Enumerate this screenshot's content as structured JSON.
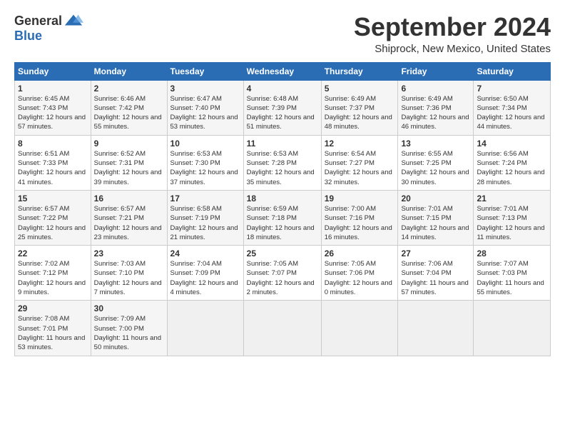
{
  "logo": {
    "general": "General",
    "blue": "Blue"
  },
  "title": "September 2024",
  "location": "Shiprock, New Mexico, United States",
  "days_of_week": [
    "Sunday",
    "Monday",
    "Tuesday",
    "Wednesday",
    "Thursday",
    "Friday",
    "Saturday"
  ],
  "weeks": [
    [
      {
        "num": "1",
        "sunrise": "6:45 AM",
        "sunset": "7:43 PM",
        "daylight": "12 hours and 57 minutes."
      },
      {
        "num": "2",
        "sunrise": "6:46 AM",
        "sunset": "7:42 PM",
        "daylight": "12 hours and 55 minutes."
      },
      {
        "num": "3",
        "sunrise": "6:47 AM",
        "sunset": "7:40 PM",
        "daylight": "12 hours and 53 minutes."
      },
      {
        "num": "4",
        "sunrise": "6:48 AM",
        "sunset": "7:39 PM",
        "daylight": "12 hours and 51 minutes."
      },
      {
        "num": "5",
        "sunrise": "6:49 AM",
        "sunset": "7:37 PM",
        "daylight": "12 hours and 48 minutes."
      },
      {
        "num": "6",
        "sunrise": "6:49 AM",
        "sunset": "7:36 PM",
        "daylight": "12 hours and 46 minutes."
      },
      {
        "num": "7",
        "sunrise": "6:50 AM",
        "sunset": "7:34 PM",
        "daylight": "12 hours and 44 minutes."
      }
    ],
    [
      {
        "num": "8",
        "sunrise": "6:51 AM",
        "sunset": "7:33 PM",
        "daylight": "12 hours and 41 minutes."
      },
      {
        "num": "9",
        "sunrise": "6:52 AM",
        "sunset": "7:31 PM",
        "daylight": "12 hours and 39 minutes."
      },
      {
        "num": "10",
        "sunrise": "6:53 AM",
        "sunset": "7:30 PM",
        "daylight": "12 hours and 37 minutes."
      },
      {
        "num": "11",
        "sunrise": "6:53 AM",
        "sunset": "7:28 PM",
        "daylight": "12 hours and 35 minutes."
      },
      {
        "num": "12",
        "sunrise": "6:54 AM",
        "sunset": "7:27 PM",
        "daylight": "12 hours and 32 minutes."
      },
      {
        "num": "13",
        "sunrise": "6:55 AM",
        "sunset": "7:25 PM",
        "daylight": "12 hours and 30 minutes."
      },
      {
        "num": "14",
        "sunrise": "6:56 AM",
        "sunset": "7:24 PM",
        "daylight": "12 hours and 28 minutes."
      }
    ],
    [
      {
        "num": "15",
        "sunrise": "6:57 AM",
        "sunset": "7:22 PM",
        "daylight": "12 hours and 25 minutes."
      },
      {
        "num": "16",
        "sunrise": "6:57 AM",
        "sunset": "7:21 PM",
        "daylight": "12 hours and 23 minutes."
      },
      {
        "num": "17",
        "sunrise": "6:58 AM",
        "sunset": "7:19 PM",
        "daylight": "12 hours and 21 minutes."
      },
      {
        "num": "18",
        "sunrise": "6:59 AM",
        "sunset": "7:18 PM",
        "daylight": "12 hours and 18 minutes."
      },
      {
        "num": "19",
        "sunrise": "7:00 AM",
        "sunset": "7:16 PM",
        "daylight": "12 hours and 16 minutes."
      },
      {
        "num": "20",
        "sunrise": "7:01 AM",
        "sunset": "7:15 PM",
        "daylight": "12 hours and 14 minutes."
      },
      {
        "num": "21",
        "sunrise": "7:01 AM",
        "sunset": "7:13 PM",
        "daylight": "12 hours and 11 minutes."
      }
    ],
    [
      {
        "num": "22",
        "sunrise": "7:02 AM",
        "sunset": "7:12 PM",
        "daylight": "12 hours and 9 minutes."
      },
      {
        "num": "23",
        "sunrise": "7:03 AM",
        "sunset": "7:10 PM",
        "daylight": "12 hours and 7 minutes."
      },
      {
        "num": "24",
        "sunrise": "7:04 AM",
        "sunset": "7:09 PM",
        "daylight": "12 hours and 4 minutes."
      },
      {
        "num": "25",
        "sunrise": "7:05 AM",
        "sunset": "7:07 PM",
        "daylight": "12 hours and 2 minutes."
      },
      {
        "num": "26",
        "sunrise": "7:05 AM",
        "sunset": "7:06 PM",
        "daylight": "12 hours and 0 minutes."
      },
      {
        "num": "27",
        "sunrise": "7:06 AM",
        "sunset": "7:04 PM",
        "daylight": "11 hours and 57 minutes."
      },
      {
        "num": "28",
        "sunrise": "7:07 AM",
        "sunset": "7:03 PM",
        "daylight": "11 hours and 55 minutes."
      }
    ],
    [
      {
        "num": "29",
        "sunrise": "7:08 AM",
        "sunset": "7:01 PM",
        "daylight": "11 hours and 53 minutes."
      },
      {
        "num": "30",
        "sunrise": "7:09 AM",
        "sunset": "7:00 PM",
        "daylight": "11 hours and 50 minutes."
      },
      null,
      null,
      null,
      null,
      null
    ]
  ]
}
